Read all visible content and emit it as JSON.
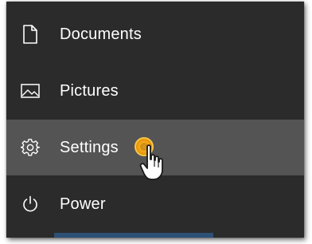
{
  "menu": {
    "items": [
      {
        "label": "Documents",
        "icon": "document-icon"
      },
      {
        "label": "Pictures",
        "icon": "pictures-icon"
      },
      {
        "label": "Settings",
        "icon": "gear-icon",
        "state": "hovered"
      },
      {
        "label": "Power",
        "icon": "power-icon"
      }
    ]
  },
  "colors": {
    "menu_background": "#2b2b2b",
    "hover_background": "#545454",
    "text": "#ffffff",
    "click_indicator": "#f2a516"
  }
}
